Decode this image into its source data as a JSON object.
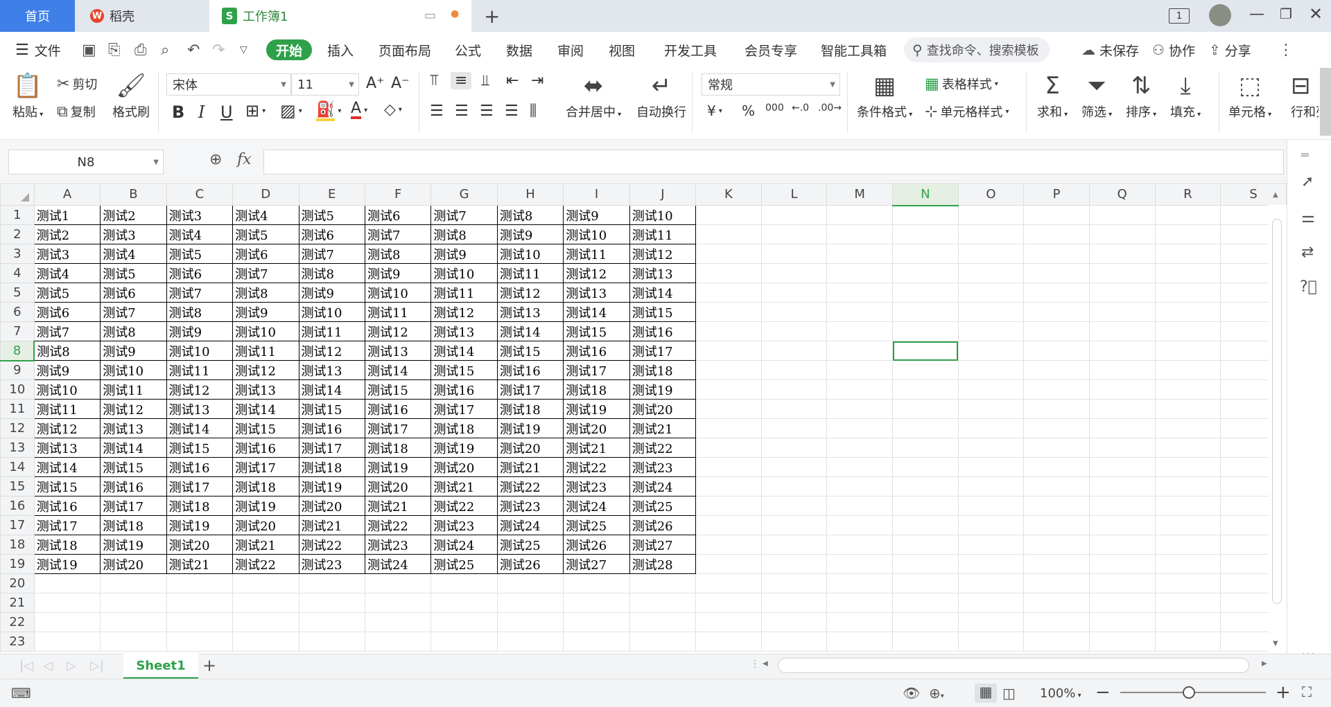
{
  "tabs": {
    "home": "首页",
    "daoke": "稻壳",
    "workbook": "工作簿1",
    "workbook_badge": "S",
    "new_tab": "+"
  },
  "titlebar": {
    "page_indicator": "1"
  },
  "menu": {
    "file": "文件",
    "items": [
      "开始",
      "插入",
      "页面布局",
      "公式",
      "数据",
      "审阅",
      "视图",
      "开发工具",
      "会员专享",
      "智能工具箱"
    ],
    "search_placeholder": "查找命令、搜索模板",
    "unsaved": "未保存",
    "collab": "协作",
    "share": "分享"
  },
  "ribbon": {
    "paste": "粘贴",
    "cut": "剪切",
    "copy": "复制",
    "format_painter": "格式刷",
    "font_name": "宋体",
    "font_size": "11",
    "bold": "B",
    "italic": "I",
    "underline": "U",
    "merge_center": "合并居中",
    "wrap_text": "自动换行",
    "number_format": "常规",
    "currency": "¥",
    "percent": "%",
    "thousands": "000",
    "cond_format": "条件格式",
    "table_style": "表格样式",
    "cell_style": "单元格样式",
    "sum": "求和",
    "filter": "筛选",
    "sort": "排序",
    "fill": "填充",
    "cell": "单元格",
    "rowcol": "行和列"
  },
  "formula_bar": {
    "name_box": "N8",
    "fx": "fx",
    "value": ""
  },
  "sheet": {
    "columns": [
      "A",
      "B",
      "C",
      "D",
      "E",
      "F",
      "G",
      "H",
      "I",
      "J",
      "K",
      "L",
      "M",
      "N",
      "O",
      "P",
      "Q",
      "R",
      "S"
    ],
    "row_numbers": [
      "1",
      "2",
      "3",
      "4",
      "5",
      "6",
      "7",
      "8",
      "9",
      "10",
      "11",
      "12",
      "13",
      "14",
      "15",
      "16",
      "17",
      "18",
      "19",
      "20",
      "21",
      "22",
      "23"
    ],
    "data": [
      [
        "测试1",
        "测试2",
        "测试3",
        "测试4",
        "测试5",
        "测试6",
        "测试7",
        "测试8",
        "测试9",
        "测试10"
      ],
      [
        "测试2",
        "测试3",
        "测试4",
        "测试5",
        "测试6",
        "测试7",
        "测试8",
        "测试9",
        "测试10",
        "测试11"
      ],
      [
        "测试3",
        "测试4",
        "测试5",
        "测试6",
        "测试7",
        "测试8",
        "测试9",
        "测试10",
        "测试11",
        "测试12"
      ],
      [
        "测试4",
        "测试5",
        "测试6",
        "测试7",
        "测试8",
        "测试9",
        "测试10",
        "测试11",
        "测试12",
        "测试13"
      ],
      [
        "测试5",
        "测试6",
        "测试7",
        "测试8",
        "测试9",
        "测试10",
        "测试11",
        "测试12",
        "测试13",
        "测试14"
      ],
      [
        "测试6",
        "测试7",
        "测试8",
        "测试9",
        "测试10",
        "测试11",
        "测试12",
        "测试13",
        "测试14",
        "测试15"
      ],
      [
        "测试7",
        "测试8",
        "测试9",
        "测试10",
        "测试11",
        "测试12",
        "测试13",
        "测试14",
        "测试15",
        "测试16"
      ],
      [
        "测试8",
        "测试9",
        "测试10",
        "测试11",
        "测试12",
        "测试13",
        "测试14",
        "测试15",
        "测试16",
        "测试17"
      ],
      [
        "测试9",
        "测试10",
        "测试11",
        "测试12",
        "测试13",
        "测试14",
        "测试15",
        "测试16",
        "测试17",
        "测试18"
      ],
      [
        "测试10",
        "测试11",
        "测试12",
        "测试13",
        "测试14",
        "测试15",
        "测试16",
        "测试17",
        "测试18",
        "测试19"
      ],
      [
        "测试11",
        "测试12",
        "测试13",
        "测试14",
        "测试15",
        "测试16",
        "测试17",
        "测试18",
        "测试19",
        "测试20"
      ],
      [
        "测试12",
        "测试13",
        "测试14",
        "测试15",
        "测试16",
        "测试17",
        "测试18",
        "测试19",
        "测试20",
        "测试21"
      ],
      [
        "测试13",
        "测试14",
        "测试15",
        "测试16",
        "测试17",
        "测试18",
        "测试19",
        "测试20",
        "测试21",
        "测试22"
      ],
      [
        "测试14",
        "测试15",
        "测试16",
        "测试17",
        "测试18",
        "测试19",
        "测试20",
        "测试21",
        "测试22",
        "测试23"
      ],
      [
        "测试15",
        "测试16",
        "测试17",
        "测试18",
        "测试19",
        "测试20",
        "测试21",
        "测试22",
        "测试23",
        "测试24"
      ],
      [
        "测试16",
        "测试17",
        "测试18",
        "测试19",
        "测试20",
        "测试21",
        "测试22",
        "测试23",
        "测试24",
        "测试25"
      ],
      [
        "测试17",
        "测试18",
        "测试19",
        "测试20",
        "测试21",
        "测试22",
        "测试23",
        "测试24",
        "测试25",
        "测试26"
      ],
      [
        "测试18",
        "测试19",
        "测试20",
        "测试21",
        "测试22",
        "测试23",
        "测试24",
        "测试25",
        "测试26",
        "测试27"
      ],
      [
        "测试19",
        "测试20",
        "测试21",
        "测试22",
        "测试23",
        "测试24",
        "测试25",
        "测试26",
        "测试27",
        "测试28"
      ]
    ],
    "active_column": "N",
    "active_row": "8"
  },
  "sheet_tabs": {
    "sheet1": "Sheet1",
    "add": "+"
  },
  "status": {
    "zoom": "100%"
  },
  "colors": {
    "accent": "#2ea14a",
    "home_tab": "#3f7fe8"
  }
}
